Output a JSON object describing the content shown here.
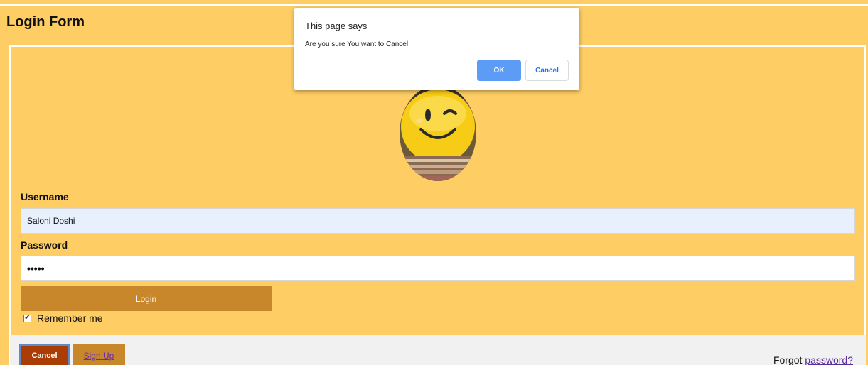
{
  "page": {
    "title": "Login Form"
  },
  "form": {
    "avatar_icon": "smiley-emoji-icon",
    "username_label": "Username",
    "username_value": "Saloni Doshi",
    "password_label": "Password",
    "password_value": "•••••",
    "login_label": "Login",
    "remember_label": "Remember me",
    "remember_checked": true
  },
  "footer": {
    "cancel_label": "Cancel",
    "signup_label": "Sign Up",
    "forgot_prefix": "Forgot ",
    "forgot_link": "password?"
  },
  "dialog": {
    "title": "This page says",
    "message": "Are you sure You want to Cancel!",
    "ok_label": "OK",
    "cancel_label": "Cancel"
  },
  "colors": {
    "page_bg": "#fecd64",
    "button_bg": "#c8872a",
    "cancel_bg": "#aa3d04",
    "dialog_ok": "#5c9cf7"
  }
}
